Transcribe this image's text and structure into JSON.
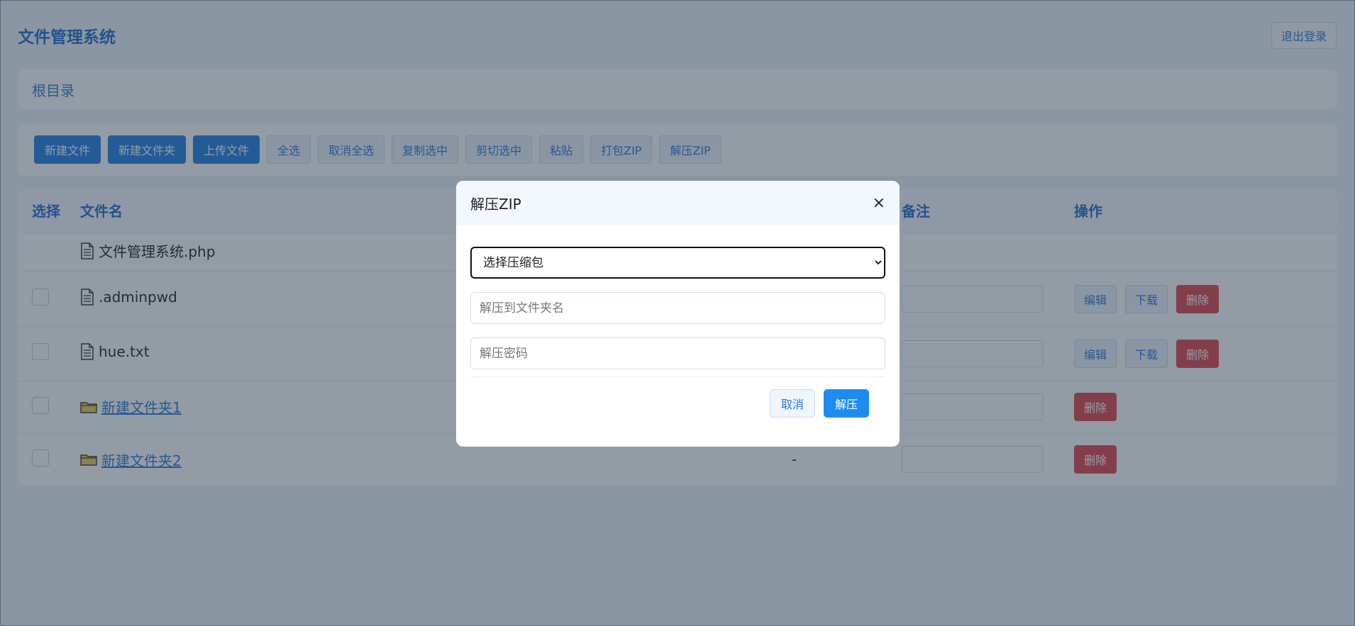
{
  "header": {
    "title": "文件管理系统",
    "logout_label": "退出登录"
  },
  "breadcrumb": {
    "root": "根目录"
  },
  "toolbar": {
    "new_file": "新建文件",
    "new_folder": "新建文件夹",
    "upload": "上传文件",
    "select_all": "全选",
    "deselect_all": "取消全选",
    "copy_selected": "复制选中",
    "cut_selected": "剪切选中",
    "paste": "粘贴",
    "pack_zip": "打包ZIP",
    "unzip": "解压ZIP"
  },
  "table": {
    "columns": {
      "select": "选择",
      "name": "文件名",
      "note": "备注",
      "actions": "操作"
    },
    "rows": [
      {
        "name": "文件管理系统.php",
        "type": "file"
      },
      {
        "name": ".adminpwd",
        "type": "file",
        "actions": [
          "编辑",
          "下载",
          "删除"
        ]
      },
      {
        "name": "hue.txt",
        "type": "file",
        "actions": [
          "编辑",
          "下载",
          "删除"
        ]
      },
      {
        "name": "新建文件夹1",
        "type": "folder",
        "actions": [
          "删除"
        ]
      },
      {
        "name": "新建文件夹2",
        "type": "folder",
        "size": "-",
        "actions": [
          "删除"
        ]
      }
    ]
  },
  "modal": {
    "title": "解压ZIP",
    "close_glyph": "×",
    "select_value": "选择压缩包",
    "folder_placeholder": "解压到文件夹名",
    "password_placeholder": "解压密码",
    "cancel_label": "取消",
    "confirm_label": "解压"
  },
  "icons": {
    "file": "file-icon",
    "folder": "folder-icon",
    "close": "close-icon"
  },
  "colors": {
    "accent": "#1e7fe0",
    "danger": "#e0454a",
    "overlay": "rgba(40,55,75,0.5)"
  }
}
